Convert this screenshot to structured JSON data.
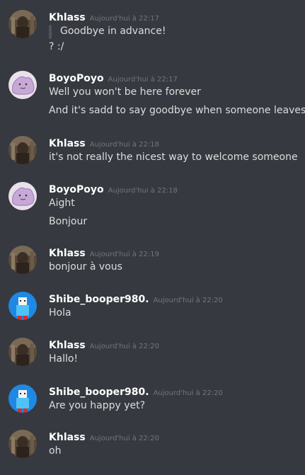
{
  "messages": [
    {
      "author": "Khlass",
      "avatar_icon": "khlass-avatar-icon",
      "timestamp": "Aujourd'hui à 22:17",
      "quote": "Goodbye in advance!",
      "lines": [
        "? :/"
      ]
    },
    {
      "author": "BoyoPoyo",
      "avatar_icon": "ditto-avatar-icon",
      "timestamp": "Aujourd'hui à 22:17",
      "lines": [
        "Well you won't be here forever",
        "And it's sadd to say goodbye when someone leaves"
      ]
    },
    {
      "author": "Khlass",
      "avatar_icon": "khlass-avatar-icon",
      "timestamp": "Aujourd'hui à 22:18",
      "lines": [
        "it's not really the nicest way to welcome someone"
      ]
    },
    {
      "author": "BoyoPoyo",
      "avatar_icon": "ditto-avatar-icon",
      "timestamp": "Aujourd'hui à 22:18",
      "lines": [
        "Aight",
        "Bonjour"
      ]
    },
    {
      "author": "Khlass",
      "avatar_icon": "khlass-avatar-icon",
      "timestamp": "Aujourd'hui à 22:19",
      "lines": [
        "bonjour à vous"
      ]
    },
    {
      "author": "Shibe_booper980.",
      "avatar_icon": "blue-character-avatar-icon",
      "timestamp": "Aujourd'hui à 22:20",
      "lines": [
        "Hola"
      ]
    },
    {
      "author": "Khlass",
      "avatar_icon": "khlass-avatar-icon",
      "timestamp": "Aujourd'hui à 22:20",
      "lines": [
        "Hallo!"
      ]
    },
    {
      "author": "Shibe_booper980.",
      "avatar_icon": "blue-character-avatar-icon",
      "timestamp": "Aujourd'hui à 22:20",
      "lines": [
        "Are you happy yet?"
      ]
    },
    {
      "author": "Khlass",
      "avatar_icon": "khlass-avatar-icon",
      "timestamp": "Aujourd'hui à 22:20",
      "lines": [
        "oh"
      ]
    }
  ],
  "colors": {
    "background": "#36393f",
    "username": "#ffffff",
    "timestamp": "#72767d",
    "text": "#dcddde",
    "quote_bar": "#4f545c"
  }
}
